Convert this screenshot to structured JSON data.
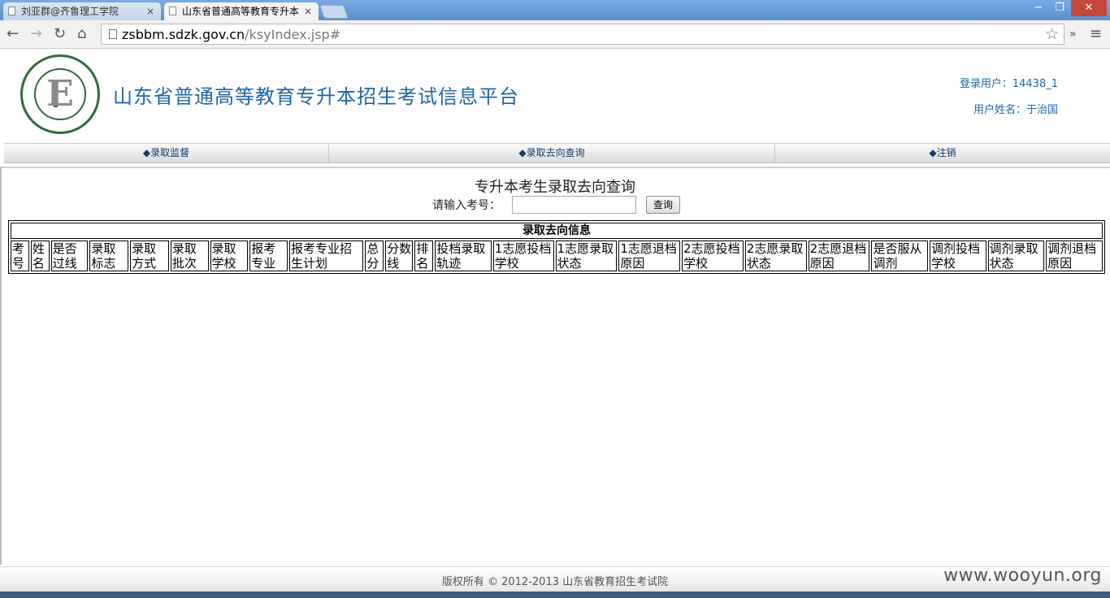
{
  "browser": {
    "tabs": [
      {
        "title": "刘亚群@齐鲁理工学院",
        "active": false
      },
      {
        "title": "山东省普通高等教育专升本",
        "active": true
      }
    ],
    "url_host": "zsbbm.sdzk.gov.cn",
    "url_path": "/ksyIndex.jsp#",
    "icons": {
      "back": "←",
      "forward": "→",
      "reload": "↻",
      "home": "⌂",
      "star": "☆",
      "more": "»",
      "menu": "≡",
      "close": "×",
      "minimize": "−",
      "maximize": "❐",
      "win_close": "✕"
    }
  },
  "header": {
    "site_title": "山东省普通高等教育专升本招生考试信息平台",
    "login_user": "登录用户：14438_1",
    "user_name": "用户姓名：于治国",
    "logo_letter": "E"
  },
  "nav": {
    "items": [
      "◆录取监督",
      "◆录取去向查询",
      "◆注销"
    ]
  },
  "query": {
    "title": "专升本考生录取去向查询",
    "label": "请输入考号：",
    "input_value": "",
    "button": "查询"
  },
  "table": {
    "caption": "录取去向信息",
    "headers": [
      "考号",
      "姓名",
      "是否过线",
      "录取标志",
      "录取方式",
      "录取批次",
      "录取学校",
      "报考专业",
      "报考专业招生计划",
      "总分",
      "分数线",
      "排名",
      "投档录取轨迹",
      "1志愿投档学校",
      "1志愿录取状态",
      "1志愿退档原因",
      "2志愿投档学校",
      "2志愿录取状态",
      "2志愿退档原因",
      "是否服从调剂",
      "调剂投档学校",
      "调剂录取状态",
      "调剂退档原因"
    ]
  },
  "footer": {
    "copyright": "版权所有 © 2012-2013 山东省教育招生考试院"
  },
  "watermark": "www.wooyun.org"
}
